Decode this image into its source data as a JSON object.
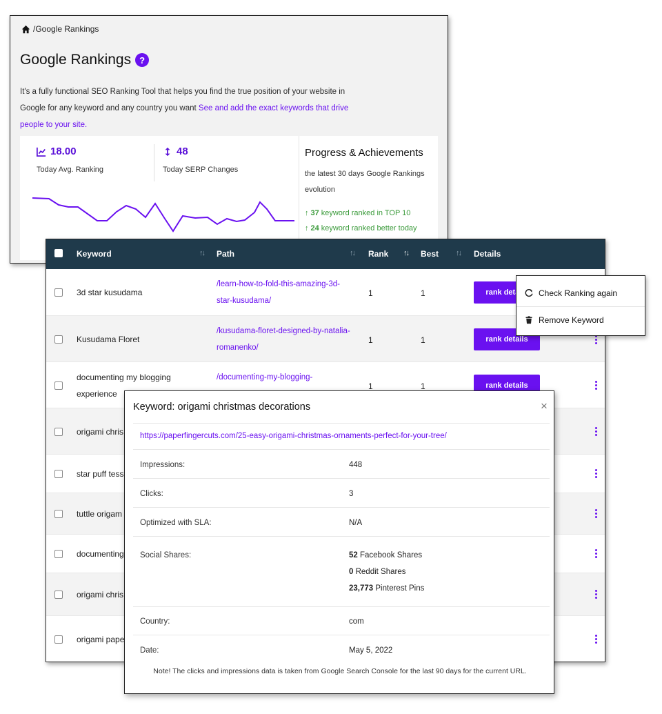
{
  "overview": {
    "breadcrumb": "/Google Rankings",
    "title": "Google Rankings",
    "help_icon": "?",
    "intro_text": "It's a fully functional SEO Ranking Tool that helps you find the true position of your website in Google for any keyword and any country you want ",
    "intro_link": "See and add the exact keywords that drive people to your site.",
    "avg_ranking_value": "18.00",
    "avg_ranking_label": "Today Avg. Ranking",
    "serp_changes_value": "48",
    "serp_changes_label": "Today SERP Changes",
    "progress_title": "Progress & Achievements",
    "progress_subtitle": "the latest 30 days Google Rankings evolution",
    "achievements": [
      {
        "count": "37",
        "text": "keyword ranked in TOP 10"
      },
      {
        "count": "24",
        "text": "keyword ranked better today"
      }
    ],
    "accent_color": "#6a11f0",
    "success_color": "#3a9a3a"
  },
  "table": {
    "header": {
      "keyword": "Keyword",
      "path": "Path",
      "rank": "Rank",
      "best": "Best",
      "details": "Details"
    },
    "header_color": "#1f3a4b",
    "rank_details_label": "rank details",
    "rows": [
      {
        "keyword": "3d star kusudama",
        "path": "/learn-how-to-fold-this-amazing-3d-star-kusudama/",
        "rank": "1",
        "best": "1"
      },
      {
        "keyword": "Kusudama Floret",
        "path": "/kusudama-floret-designed-by-natalia-romanenko/",
        "rank": "1",
        "best": "1"
      },
      {
        "keyword": "documenting my blogging experience",
        "path": "/documenting-my-blogging-",
        "rank": "1",
        "best": "1"
      },
      {
        "keyword": "origami chris"
      },
      {
        "keyword": "star puff tess"
      },
      {
        "keyword": "tuttle origam"
      },
      {
        "keyword": "documenting"
      },
      {
        "keyword": "origami chris"
      },
      {
        "keyword": "origami pape"
      }
    ]
  },
  "context_menu": {
    "check_again": "Check Ranking again",
    "remove": "Remove Keyword"
  },
  "modal": {
    "title": "Keyword: origami christmas decorations",
    "close": "×",
    "url": "https://paperfingercuts.com/25-easy-origami-christmas-ornaments-perfect-for-your-tree/",
    "impressions_label": "Impressions:",
    "impressions_value": "448",
    "clicks_label": "Clicks:",
    "clicks_value": "3",
    "sla_label": "Optimized with SLA:",
    "sla_value": "N/A",
    "social_label": "Social Shares:",
    "social": [
      {
        "count": "52",
        "text": "Facebook Shares"
      },
      {
        "count": "0",
        "text": "Reddit Shares"
      },
      {
        "count": "23,773",
        "text": "Pinterest Pins"
      }
    ],
    "country_label": "Country:",
    "country_value": "com",
    "date_label": "Date:",
    "date_value": "May 5, 2022",
    "note": "Note! The clicks and impressions data is taken from Google Search Console for the last 90 days for the current URL."
  }
}
